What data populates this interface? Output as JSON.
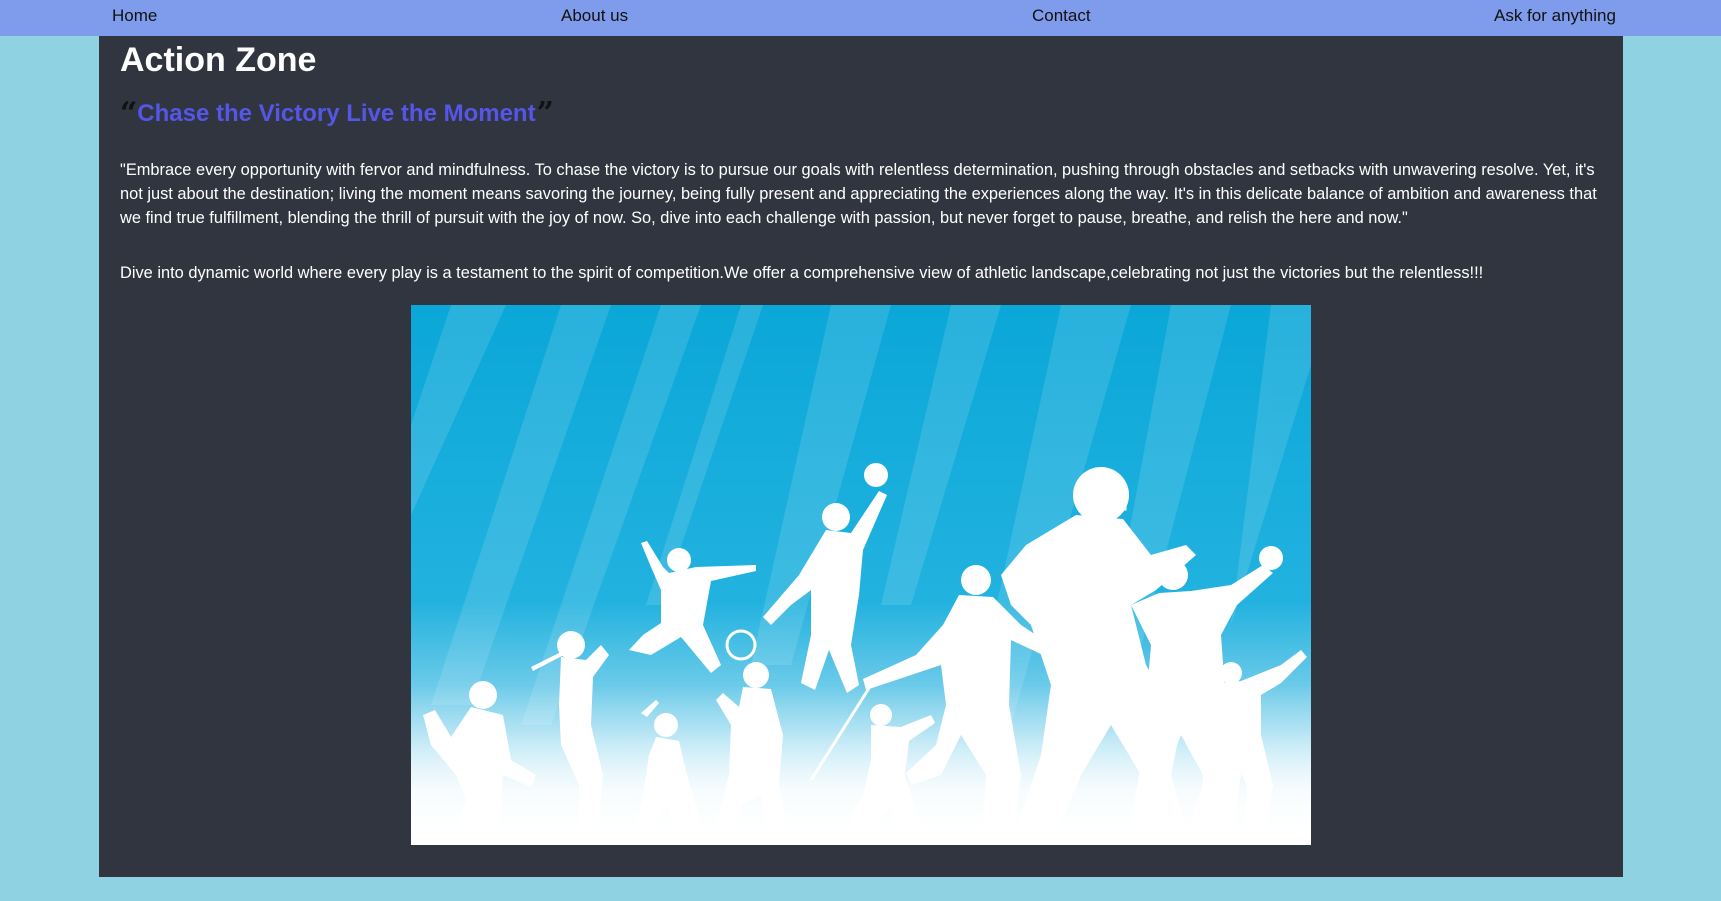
{
  "nav": {
    "home": "Home",
    "about": "About us",
    "contact": "Contact",
    "ask": "Ask for anything"
  },
  "page": {
    "title": "Action Zone",
    "tagline": "Chase the Victory Live the Moment",
    "quote": "\"Embrace every opportunity with fervor and mindfulness. To chase the victory is to pursue our goals with relentless determination, pushing through obstacles and setbacks with unwavering resolve. Yet, it's not just about the destination; living the moment means savoring the journey, being fully present and appreciating the experiences along the way. It's in this delicate balance of ambition and awareness that we find true fulfillment, blending the thrill of pursuit with the joy of now. So, dive into each challenge with passion, but never forget to pause, breathe, and relish the here and now.\"",
    "intro": "Dive into dynamic world where every play is a testament to the spirit of competition.We offer a comprehensive view of athletic landscape,celebrating not just the victories but the relentless!!!"
  },
  "hero_image": {
    "subject": "sports-silhouettes-illustration"
  },
  "colors": {
    "page_background": "#8fd3e3",
    "nav_background": "#7f9cec",
    "panel_background": "#31353f",
    "tagline": "#5556e8",
    "hero_sky": "#0aa7d8"
  }
}
